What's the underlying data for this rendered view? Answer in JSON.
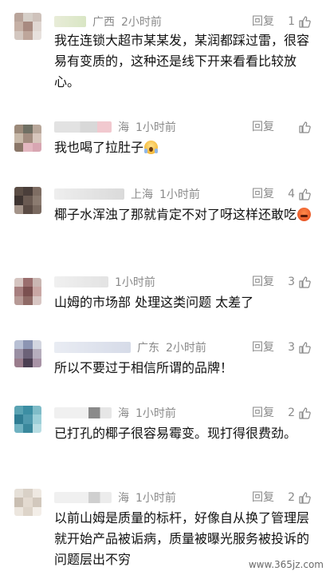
{
  "comments": [
    {
      "location": "广西",
      "time": "2小时前",
      "reply": "回复",
      "likes": "1",
      "text": "我在连锁大超市某某发，某润都踩过雷，很容易有变质的，这种还是线下开来看看比较放心。"
    },
    {
      "location": "海",
      "time": "1小时前",
      "reply": "回复",
      "likes": "",
      "text": "我也喝了拉肚子"
    },
    {
      "location": "上海",
      "time": "1小时前",
      "reply": "回复",
      "likes": "4",
      "text": "椰子水浑浊了那就肯定不对了呀这样还敢吃"
    },
    {
      "location": "",
      "time": "1小时前",
      "reply": "回复",
      "likes": "3",
      "text": "山姆的市场部 处理这类问题 太差了"
    },
    {
      "location": "广东",
      "time": "2小时前",
      "reply": "回复",
      "likes": "3",
      "text": "所以不要过于相信所谓的品牌！"
    },
    {
      "location": "海",
      "time": "1小时前",
      "reply": "回复",
      "likes": "2",
      "text": "已打孔的椰子很容易霉变。现打得很费劲。"
    },
    {
      "location": "海",
      "time": "1小时前",
      "reply": "回复",
      "likes": "2",
      "text": "以前山姆是质量的标杆，好像自从换了管理层就开始产品被诟病，质量被曝光服务被投诉的问题层出不穷"
    }
  ],
  "emojis": {
    "scream": "scream-emoji",
    "angry": "angry-emoji"
  },
  "watermark": "www.365jz.com"
}
